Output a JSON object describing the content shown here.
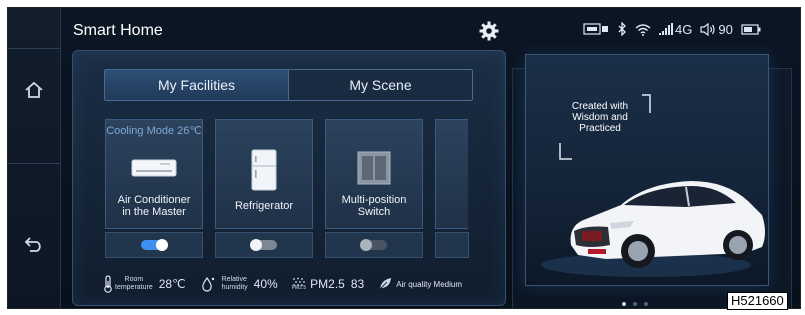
{
  "header": {
    "title": "Smart Home"
  },
  "status_bar": {
    "signal": "4G",
    "volume": "90"
  },
  "tabs": [
    {
      "label": "My Facilities",
      "active": true
    },
    {
      "label": "My Scene",
      "active": false
    }
  ],
  "devices": [
    {
      "mode": "Cooling Mode 26℃",
      "label_line1": "Air Conditioner",
      "label_line2": "in the Master",
      "on": true
    },
    {
      "mode": "",
      "label_line1": "Refrigerator",
      "label_line2": "",
      "on": false
    },
    {
      "mode": "",
      "label_line1": "Multi-position",
      "label_line2": "Switch",
      "on": false
    }
  ],
  "environment": {
    "room_label_1": "Room",
    "room_label_2": "temperature",
    "room_value": "28℃",
    "humidity_label_1": "Relative",
    "humidity_label_2": "humidity",
    "humidity_value": "40%",
    "pm_icon_text": "PM2.5",
    "pm_label": "PM2.5",
    "pm_value": "83",
    "air_quality": "Air quality Medium"
  },
  "promo": {
    "line1": "Created with",
    "line2": "Wisdom and",
    "line3": "Practiced"
  },
  "carousel": {
    "total": 3,
    "active_index": 0
  },
  "figure_code": "H521660",
  "colors": {
    "accent": "#3d8ff0",
    "panel_border": "#34506f",
    "background": "#0a1320"
  },
  "icons": [
    "home-icon",
    "back-icon",
    "gear-icon",
    "sim-icon",
    "bluetooth-icon",
    "wifi-icon",
    "signal-icon",
    "volume-icon",
    "battery-icon",
    "thermometer-icon",
    "humidity-icon",
    "leaf-icon"
  ]
}
